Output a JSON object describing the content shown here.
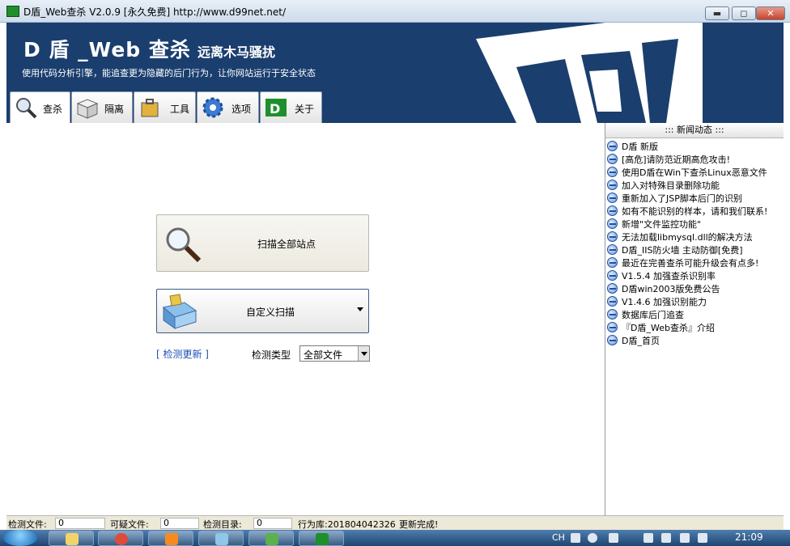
{
  "window": {
    "title": "D盾_Web查杀 V2.0.9 [永久免费] http://www.d99net.net/",
    "minimize_label": "▬",
    "maximize_label": "◻",
    "close_label": "✕"
  },
  "banner": {
    "app_name": "D 盾 _Web 查杀",
    "slogan": "远离木马骚扰",
    "tagline": "使用代码分析引擎，能追查更为隐藏的后门行为，让你网站运行于安全状态"
  },
  "tabs": [
    {
      "label": "查杀",
      "icon": "magnifier-icon",
      "active": true
    },
    {
      "label": "隔离",
      "icon": "box-icon",
      "active": false
    },
    {
      "label": "工具",
      "icon": "toolbox-icon",
      "active": false
    },
    {
      "label": "选项",
      "icon": "gear-icon",
      "active": false
    },
    {
      "label": "关于",
      "icon": "d-logo-icon",
      "active": false
    }
  ],
  "main": {
    "scan_all_label": "扫描全部站点",
    "custom_scan_label": "自定义扫描",
    "check_update_label": "[ 检测更新 ]",
    "detect_type_label": "检测类型",
    "detect_type_value": "全部文件"
  },
  "news": {
    "header": "::: 新闻动态 :::",
    "items": [
      "D盾 新版",
      "[高危]请防范近期高危攻击!",
      "使用D盾在Win下查杀Linux恶意文件",
      "加入对特殊目录删除功能",
      "重新加入了JSP脚本后门的识别",
      "如有不能识别的样本，请和我们联系!",
      "新增\"文件监控功能\"",
      "无法加载libmysql.dll的解决方法",
      "D盾_IIS防火墙 主动防御[免费]",
      "最近在完善查杀可能升级会有点多!",
      "V1.5.4 加强查杀识别率",
      "D盾win2003版免费公告",
      "V1.4.6 加强识别能力",
      "数据库后门追查",
      "『D盾_Web查杀』介绍",
      "D盾_首页"
    ]
  },
  "statusbar": {
    "detect_files_label": "检测文件:",
    "detect_files_value": "0",
    "suspicious_files_label": "可疑文件:",
    "suspicious_files_value": "0",
    "detect_dirs_label": "检测目录:",
    "detect_dirs_value": "0",
    "rule_db_label": "行为库:201804042326",
    "update_status": "更新完成!"
  },
  "taskbar": {
    "lang": "CH",
    "clock": "21:09"
  },
  "colors": {
    "banner_bg": "#1a3e6e",
    "link": "#1c4fb5",
    "accent_green": "#1f8f2c"
  }
}
